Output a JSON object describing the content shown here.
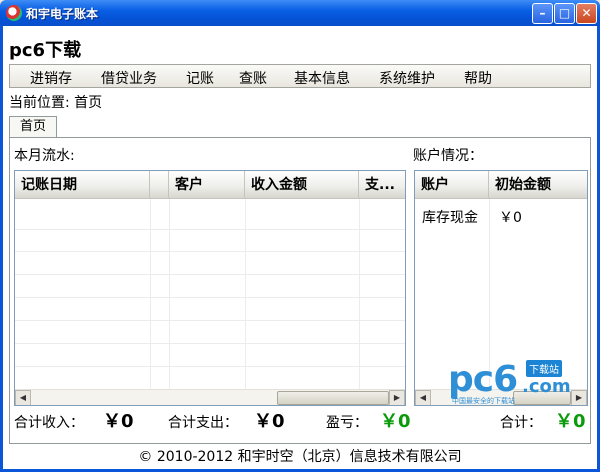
{
  "window": {
    "title": "和宇电子账本"
  },
  "company_name": "pc6下载",
  "menu": [
    "进销存",
    "借贷业务",
    "记账",
    "查账",
    "基本信息",
    "系统维护",
    "帮助"
  ],
  "location": "当前位置: 首页",
  "tab": "首页",
  "flow": {
    "label": "本月流水:",
    "columns": [
      "记账日期",
      "",
      "客户",
      "收入金额",
      "支..."
    ]
  },
  "account": {
    "label": "账户情况：",
    "columns": [
      "账户",
      "初始金额"
    ],
    "rows": [
      {
        "name": "库存现金",
        "amount": "￥0"
      }
    ]
  },
  "totals": {
    "income_label": "合计收入：",
    "income_value": "￥0",
    "expense_label": "合计支出：",
    "expense_value": "￥0",
    "profit_label": "盈亏：",
    "profit_value": "￥0",
    "sum_label": "合计：",
    "sum_value": "￥0"
  },
  "footer": "© 2010-2012  和宇时空（北京）信息技术有限公司",
  "watermark": {
    "main": "pc6",
    "badge": "下载站",
    "domain": ".com",
    "sub": "中国最安全的下载站"
  },
  "colors": {
    "title_bar": "#0A5FE4",
    "accent_green": "#0A9A0A"
  }
}
